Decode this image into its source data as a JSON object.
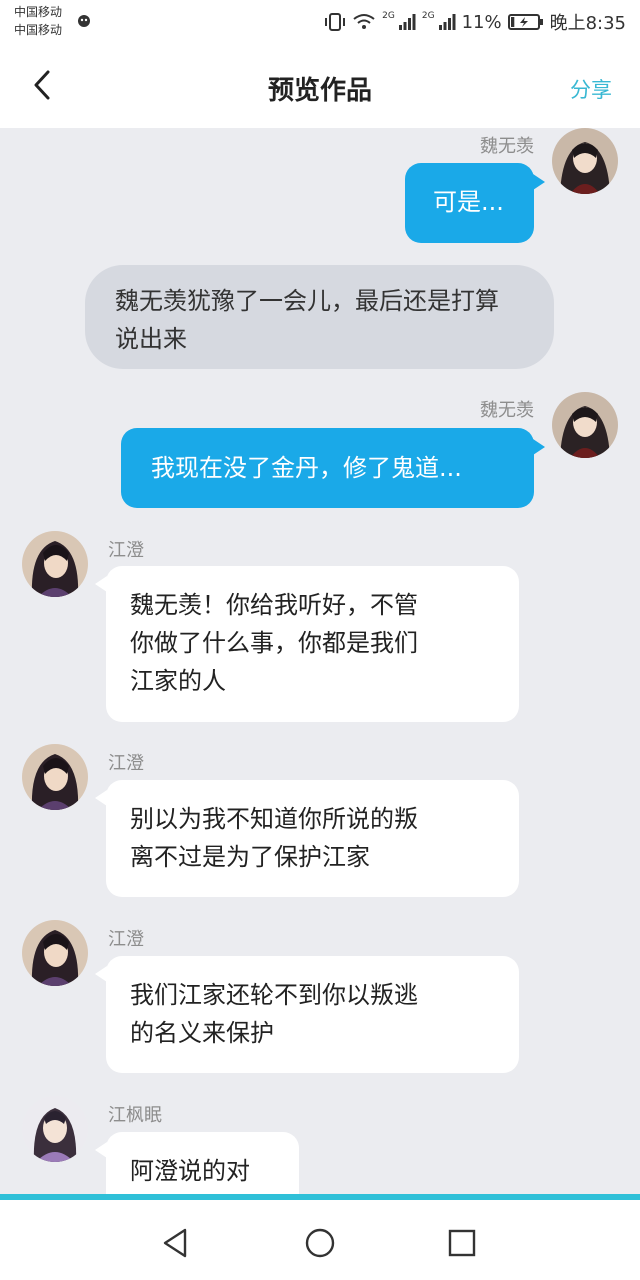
{
  "status": {
    "carrier1": "中国移动",
    "carrier2": "中国移动",
    "net1": "2G",
    "net2": "2G",
    "battery": "11%",
    "time": "晚上8:35"
  },
  "header": {
    "title": "预览作品",
    "share": "分享"
  },
  "messages": [
    {
      "side": "right",
      "name": "魏无羡",
      "text": "可是..."
    },
    {
      "side": "narration",
      "text_line1": "魏无羡犹豫了一会儿，最后还是打算",
      "text_line2": "说出来"
    },
    {
      "side": "right",
      "name": "魏无羡",
      "text": "我现在没了金丹，修了鬼道..."
    },
    {
      "side": "left",
      "name": "江澄",
      "lines": [
        "魏无羡！你给我听好，不管",
        "你做了什么事，你都是我们",
        "江家的人"
      ]
    },
    {
      "side": "left",
      "name": "江澄",
      "lines": [
        "别以为我不知道你所说的叛",
        "离不过是为了保护江家"
      ]
    },
    {
      "side": "left",
      "name": "江澄",
      "lines": [
        "我们江家还轮不到你以叛逃",
        "的名义来保护"
      ]
    },
    {
      "side": "left",
      "name": "江枫眠",
      "lines": [
        "阿澄说的对"
      ]
    }
  ],
  "colors": {
    "accent": "#39b8d3",
    "bubble_right": "#1aa9e8",
    "chat_bg": "#ebecf0"
  },
  "icons": [
    "back-arrow-icon",
    "nav-back-icon",
    "nav-home-icon",
    "nav-recent-icon"
  ]
}
